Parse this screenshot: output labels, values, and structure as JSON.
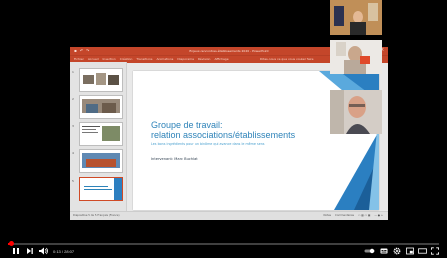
{
  "app": {
    "window_title": "Enjeux-rencontres-établissements 2020 - PowerPoint",
    "ribbon_tabs": [
      "Fichier",
      "Accueil",
      "Insertion",
      "Création",
      "Transitions",
      "Animations",
      "Diaporama",
      "Révision",
      "Affichage"
    ],
    "tell_me": "Dites-nous ce que vous voulez faire"
  },
  "slide": {
    "title_line1": "Groupe de travail:",
    "title_line2": "relation associations/établissements",
    "subtitle": "Les bons ingrédients pour un binôme qui avance dans le même sens",
    "speaker": "Intervenant: Marc Buchlat"
  },
  "thumbnails": [
    "1",
    "2",
    "3",
    "4",
    "5"
  ],
  "statusbar": {
    "left": "Diapositive 5 de 5  Français (France)",
    "notes": "Notes",
    "comments": "Commentaires"
  },
  "player": {
    "time": "0:13 / 28:07",
    "progress": 0.008
  },
  "colors": {
    "ppt_accent": "#c4462a",
    "slide_title": "#2e83b9",
    "progress": "#ff0000"
  }
}
